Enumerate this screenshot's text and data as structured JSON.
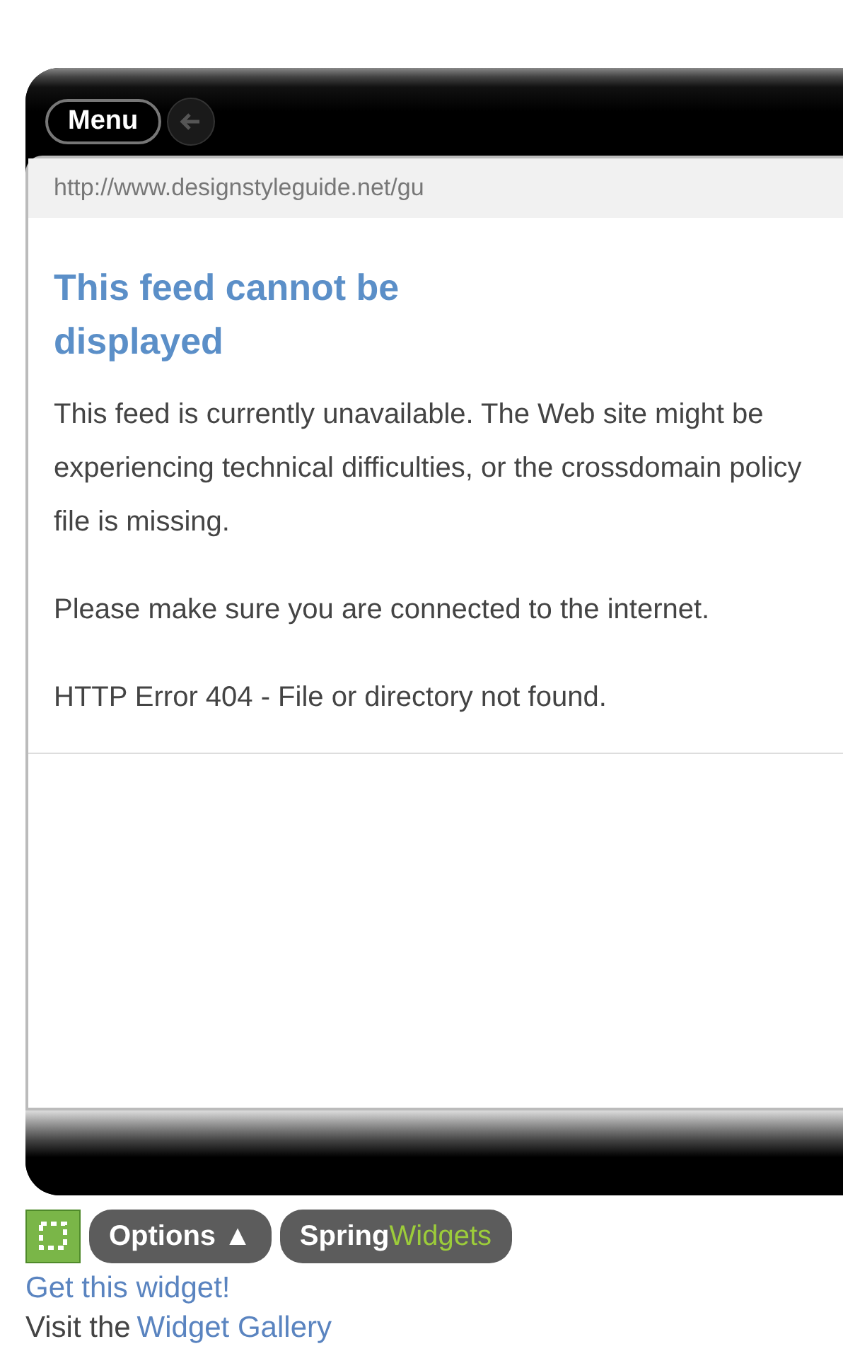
{
  "widget": {
    "menu_button": "Menu",
    "url": "http://www.designstyleguide.net/gu",
    "title": "This feed cannot be displayed",
    "paragraphs": [
      "This feed is currently unavailable. The Web site might be experiencing technical difficulties, or the crossdomain policy file is missing.",
      "Please make sure you are connected to the internet.",
      "HTTP Error 404 - File or directory not found."
    ]
  },
  "footer": {
    "options_button": {
      "label": "Options",
      "arrow": "▲"
    },
    "brand": {
      "part_1": "Spring",
      "part_2": "Widgets"
    },
    "get_link": "Get this widget!",
    "gallery_prefix": "Visit the",
    "gallery_link": "Widget Gallery"
  }
}
